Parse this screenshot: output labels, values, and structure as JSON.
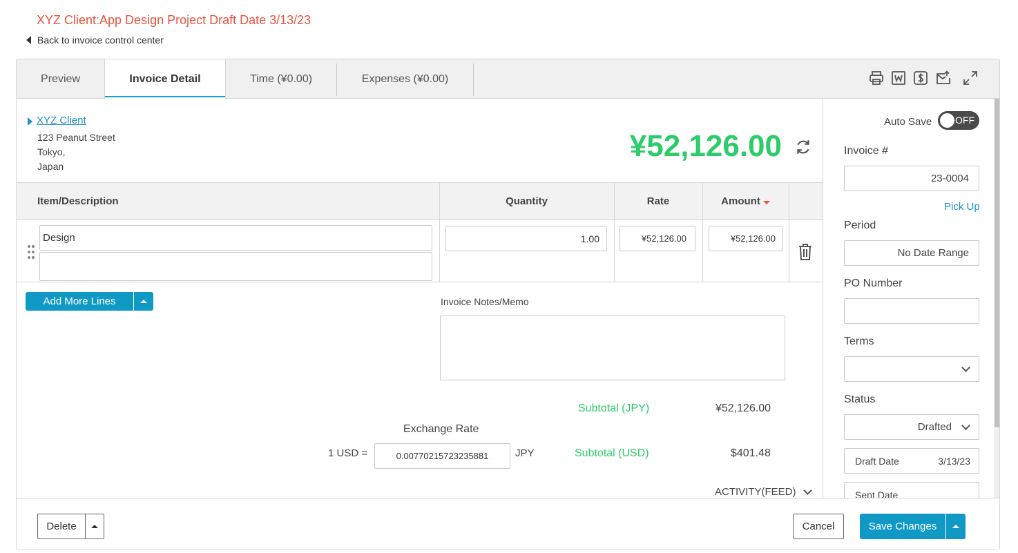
{
  "page": {
    "title": "XYZ Client:App Design Project Draft Date 3/13/23",
    "back_link": "Back to invoice control center"
  },
  "tabs": [
    {
      "label": "Preview"
    },
    {
      "label": "Invoice Detail"
    },
    {
      "label": "Time (¥0.00)"
    },
    {
      "label": "Expenses (¥0.00)"
    }
  ],
  "toolbar": {
    "icons": [
      "printer-icon",
      "word-export-icon",
      "payment-icon",
      "email-send-icon",
      "expand-icon"
    ]
  },
  "client": {
    "name": "XYZ Client",
    "address_line1": "123 Peanut Street",
    "address_line2": "Tokyo,",
    "address_line3": "Japan"
  },
  "invoice_total": "¥52,126.00",
  "table": {
    "headers": {
      "item": "Item/Description",
      "quantity": "Quantity",
      "rate": "Rate",
      "amount": "Amount"
    },
    "rows": [
      {
        "item": "Design",
        "description": "",
        "quantity": "1.00",
        "rate": "¥52,126.00",
        "amount": "¥52,126.00"
      }
    ]
  },
  "add_lines_label": "Add More Lines",
  "notes": {
    "label": "Invoice Notes/Memo",
    "value": ""
  },
  "totals": {
    "subtotal_jpy_label": "Subtotal (JPY)",
    "subtotal_jpy_value": "¥52,126.00",
    "subtotal_usd_label": "Subtotal (USD)",
    "subtotal_usd_value": "$401.48"
  },
  "exchange": {
    "label": "Exchange Rate",
    "lhs": "1 USD =",
    "rate": "0.00770215723235881",
    "currency": "JPY"
  },
  "activity_label": "ACTIVITY(FEED)",
  "sidebar": {
    "auto_save_label": "Auto Save",
    "auto_save_state": "OFF",
    "invoice_no_label": "Invoice #",
    "invoice_no": "23-0004",
    "pick_up": "Pick Up",
    "period_label": "Period",
    "period_value": "No Date Range",
    "po_label": "PO Number",
    "po_value": "",
    "terms_label": "Terms",
    "terms_value": "",
    "status_label": "Status",
    "status_value": "Drafted",
    "draft_date_label": "Draft Date",
    "draft_date_value": "3/13/23",
    "sent_date_label": "Sent Date"
  },
  "footer": {
    "delete": "Delete",
    "cancel": "Cancel",
    "save": "Save Changes"
  },
  "colors": {
    "title": "#e8543e",
    "accent": "#1199c6",
    "total_green": "#2dcc6a",
    "sort_red": "#e8543e"
  }
}
